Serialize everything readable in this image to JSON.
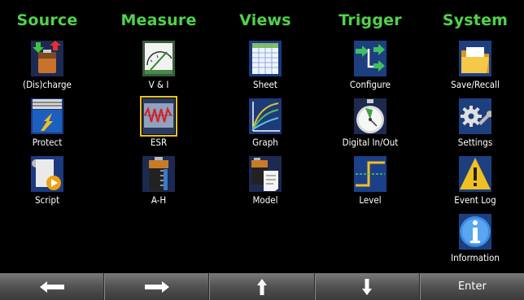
{
  "menu": {
    "columns": [
      {
        "title": "Source",
        "items": [
          {
            "label": "(Dis)charge",
            "icon": "battery-charge-icon"
          },
          {
            "label": "Protect",
            "icon": "protect-icon"
          },
          {
            "label": "Script",
            "icon": "script-icon"
          }
        ]
      },
      {
        "title": "Measure",
        "items": [
          {
            "label": "V & I",
            "icon": "meter-gauge-icon"
          },
          {
            "label": "ESR",
            "icon": "esr-waveform-icon",
            "selected": true
          },
          {
            "label": "A-H",
            "icon": "battery-ah-icon"
          }
        ]
      },
      {
        "title": "Views",
        "items": [
          {
            "label": "Sheet",
            "icon": "sheet-icon"
          },
          {
            "label": "Graph",
            "icon": "graph-icon"
          },
          {
            "label": "Model",
            "icon": "battery-model-icon"
          }
        ]
      },
      {
        "title": "Trigger",
        "items": [
          {
            "label": "Configure",
            "icon": "trigger-configure-icon"
          },
          {
            "label": "Digital In/Out",
            "icon": "stopwatch-icon"
          },
          {
            "label": "Level",
            "icon": "level-step-icon"
          }
        ]
      },
      {
        "title": "System",
        "items": [
          {
            "label": "Save/Recall",
            "icon": "folder-icon"
          },
          {
            "label": "Settings",
            "icon": "settings-gear-icon"
          },
          {
            "label": "Event Log",
            "icon": "warning-icon"
          },
          {
            "label": "Information",
            "icon": "info-icon"
          }
        ]
      }
    ]
  },
  "softkeys": [
    {
      "label": "",
      "icon": "arrow-left-icon"
    },
    {
      "label": "",
      "icon": "arrow-right-icon"
    },
    {
      "label": "",
      "icon": "arrow-up-icon"
    },
    {
      "label": "",
      "icon": "arrow-down-icon"
    },
    {
      "label": "Enter",
      "icon": ""
    }
  ],
  "colors": {
    "accent": "#4fd34a",
    "selection": "#e8c21a",
    "background": "#000000"
  }
}
